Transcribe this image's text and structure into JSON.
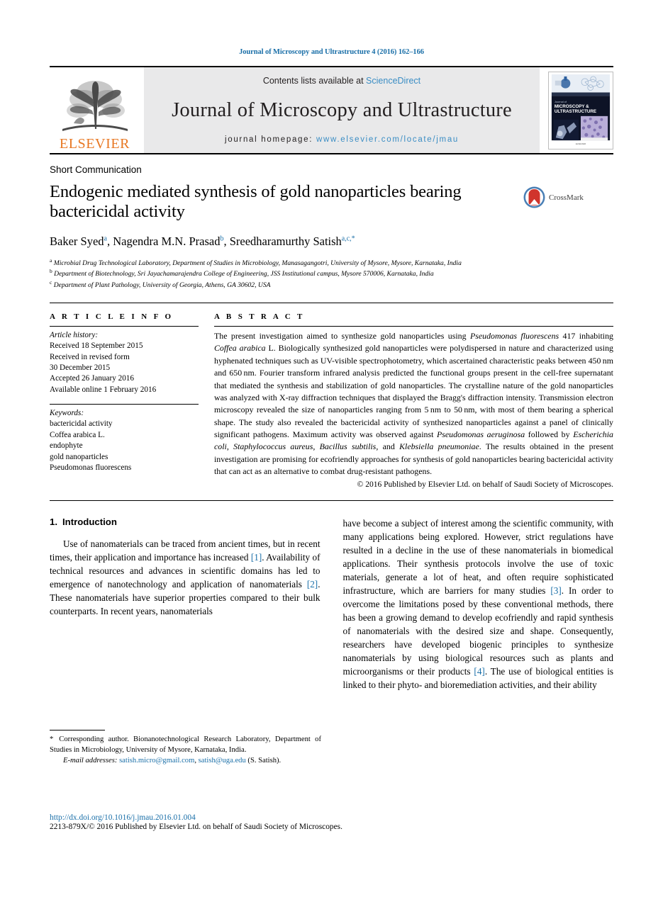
{
  "running_head": "Journal of Microscopy and Ultrastructure 4 (2016) 162–166",
  "masthead": {
    "publisher_name": "ELSEVIER",
    "contents_prefix": "Contents lists available at ",
    "contents_link": "ScienceDirect",
    "journal_name": "Journal of Microscopy and Ultrastructure",
    "homepage_prefix": "journal homepage: ",
    "homepage_url": "www.elsevier.com/locate/jmau",
    "cover_title_line1": "Journal of",
    "cover_title_line2": "MICROSCOPY &",
    "cover_title_line3": "ULTRASTRUCTURE"
  },
  "article": {
    "type": "Short Communication",
    "title": "Endogenic mediated synthesis of gold nanoparticles bearing bactericidal activity",
    "crossmark_label": "CrossMark",
    "authors": [
      {
        "name": "Baker Syed",
        "sup": "a",
        "sep": ", "
      },
      {
        "name": "Nagendra M.N. Prasad",
        "sup": "b",
        "sep": ", "
      },
      {
        "name": "Sreedharamurthy Satish",
        "sup": "a,c,*",
        "sep": ""
      }
    ],
    "affiliations": [
      {
        "mark": "a",
        "text": "Microbial Drug Technological Laboratory, Department of Studies in Microbiology, Manasagangotri, University of Mysore, Mysore, Karnataka, India"
      },
      {
        "mark": "b",
        "text": "Department of Biotechnology, Sri Jayachamarajendra College of Engineering, JSS Institutional campus, Mysore 570006, Karnataka, India"
      },
      {
        "mark": "c",
        "text": "Department of Plant Pathology, University of Georgia, Athens, GA 30602, USA"
      }
    ]
  },
  "article_info": {
    "heading": "A R T I C L E   I N F O",
    "history_label": "Article history:",
    "history": [
      "Received 18 September 2015",
      "Received in revised form",
      "30 December 2015",
      "Accepted 26 January 2016",
      "Available online 1 February 2016"
    ],
    "keywords_label": "Keywords:",
    "keywords": [
      {
        "text": "bactericidal activity",
        "italic": false
      },
      {
        "text": "Coffea arabica L.",
        "italic": true
      },
      {
        "text": "endophyte",
        "italic": false
      },
      {
        "text": "gold nanoparticles",
        "italic": false
      },
      {
        "text": "Pseudomonas fluorescens",
        "italic": true
      }
    ]
  },
  "abstract": {
    "heading": "A B S T R A C T",
    "paragraphs": [
      "The present investigation aimed to synthesize gold nanoparticles using <i>Pseudomonas fluorescens</i> 417 inhabiting <i>Coffea arabica</i> L. Biologically synthesized gold nanoparticles were polydispersed in nature and characterized using hyphenated techniques such as UV-visible spectrophotometry, which ascertained characteristic peaks between 450&thinsp;nm and 650&thinsp;nm. Fourier transform infrared analysis predicted the functional groups present in the cell-free supernatant that mediated the synthesis and stabilization of gold nanoparticles. The crystalline nature of the gold nanoparticles was analyzed with X-ray diffraction techniques that displayed the Bragg's diffraction intensity. Transmission electron microscopy revealed the size of nanoparticles ranging from 5&thinsp;nm to 50&thinsp;nm, with most of them bearing a spherical shape. The study also revealed the bactericidal activity of synthesized nanoparticles against a panel of clinically significant pathogens. Maximum activity was observed against <i>Pseudomonas aeruginosa</i> followed by <i>Escherichia coli</i>, <i>Staphylococcus aureus</i>, <i>Bacillus subtilis</i>, and <i>Klebsiella pneumoniae</i>. The results obtained in the present investigation are promising for ecofriendly approaches for synthesis of gold nanoparticles bearing bactericidal activity that can act as an alternative to combat drug-resistant pathogens."
    ],
    "copyright": "© 2016 Published by Elsevier Ltd. on behalf of Saudi Society of Microscopes."
  },
  "body": {
    "section_number": "1.",
    "section_title": "Introduction",
    "left_paragraph": "Use of nanomaterials can be traced from ancient times, but in recent times, their application and importance has increased <span class=\"ref\">[1]</span>. Availability of technical resources and advances in scientific domains has led to emergence of nanotechnology and application of nanomaterials <span class=\"ref\">[2]</span>. These nanomaterials have superior properties compared to their bulk counterparts. In recent years, nanomaterials",
    "right_paragraph": "have become a subject of interest among the scientific community, with many applications being explored. However, strict regulations have resulted in a decline in the use of these nanomaterials in biomedical applications. Their synthesis protocols involve the use of toxic materials, generate a lot of heat, and often require sophisticated infrastructure, which are barriers for many studies <span class=\"ref\">[3]</span>. In order to overcome the limitations posed by these conventional methods, there has been a growing demand to develop ecofriendly and rapid synthesis of nanomaterials with the desired size and shape. Consequently, researchers have developed biogenic principles to synthesize nanomaterials by using biological resources such as plants and microorganisms or their products <span class=\"ref\">[4]</span>. The use of biological entities is linked to their phyto- and bioremediation activities, and their ability"
  },
  "footnote": {
    "star": "*",
    "corresponding": "Corresponding author. Bionanotechnological Research Laboratory, Department of Studies in Microbiology, University of Mysore, Karnataka, India.",
    "email_label": "E-mail addresses:",
    "email1": "satish.micro@gmail.com",
    "email_sep": ", ",
    "email2": "satish@uga.edu",
    "email_suffix": " (S. Satish)."
  },
  "page_footer": {
    "doi": "http://dx.doi.org/10.1016/j.jmau.2016.01.004",
    "issn_line": "2213-879X/© 2016 Published by Elsevier Ltd. on behalf of Saudi Society of Microscopes."
  },
  "colors": {
    "link": "#1a6fa8",
    "sciencedirect": "#3a8dc4",
    "elsevier_orange": "#E87722",
    "masthead_bg": "#e9e9ea"
  }
}
